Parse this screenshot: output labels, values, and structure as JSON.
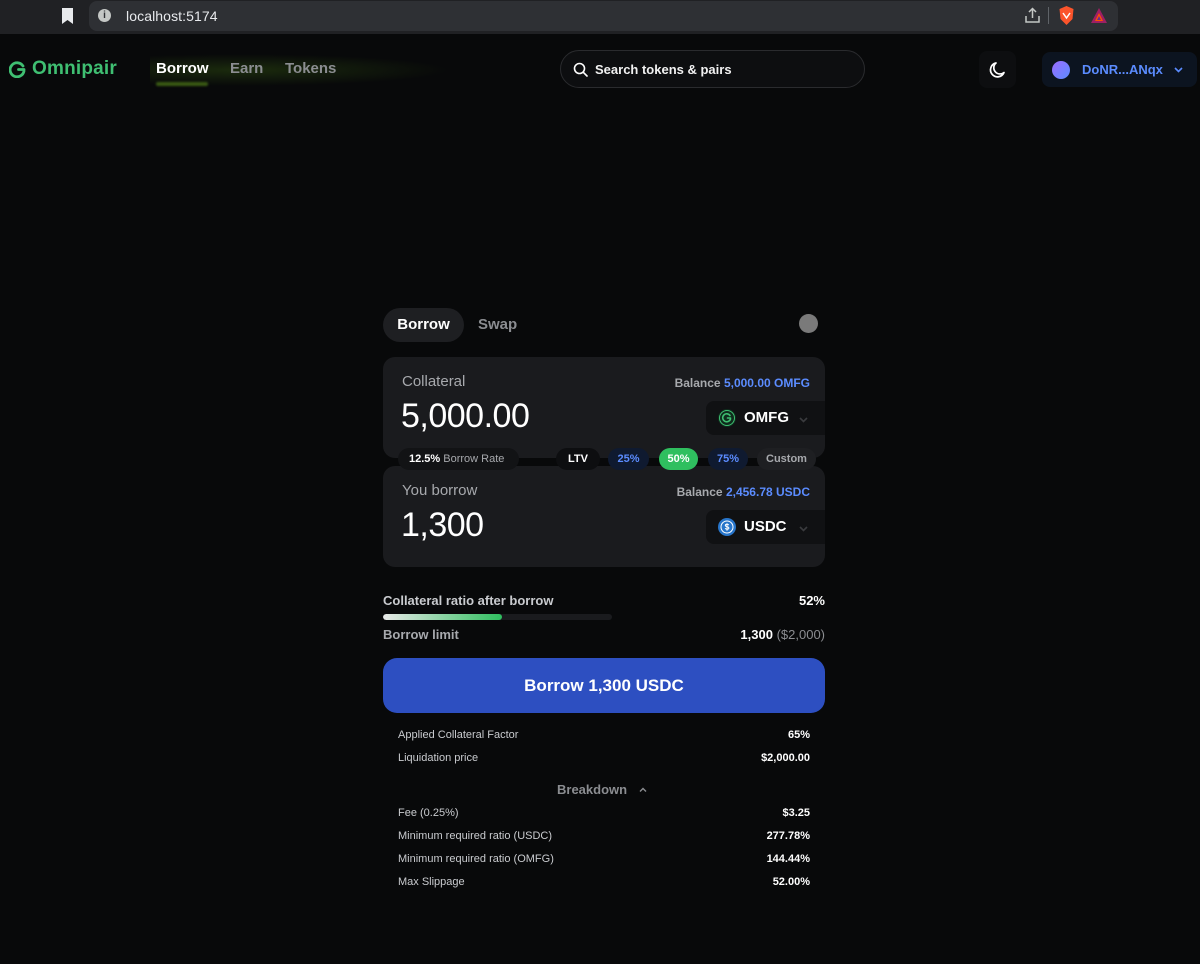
{
  "browser": {
    "url": "localhost:5174"
  },
  "header": {
    "logo": "Omnipair",
    "nav": {
      "borrow": "Borrow",
      "earn": "Earn",
      "tokens": "Tokens"
    },
    "search_placeholder": "Search tokens & pairs",
    "wallet": "DoNR...ANqx"
  },
  "tabs": {
    "borrow": "Borrow",
    "swap": "Swap"
  },
  "collateral": {
    "label": "Collateral",
    "balance_label": "Balance",
    "balance_value": "5,000.00 OMFG",
    "amount": "5,000.00",
    "token": "OMFG"
  },
  "rate": {
    "value": "12.5%",
    "label": "Borrow Rate"
  },
  "ltv": {
    "label": "LTV",
    "options": [
      "25%",
      "50%",
      "75%",
      "Custom"
    ],
    "selected": "50%"
  },
  "borrow": {
    "label": "You borrow",
    "balance_label": "Balance",
    "balance_value": "2,456.78 USDC",
    "amount": "1,300",
    "token": "USDC"
  },
  "ratio": {
    "label": "Collateral ratio after borrow",
    "value": "52%",
    "fill_percent": 52
  },
  "limit": {
    "label": "Borrow limit",
    "value": "1,300",
    "sub": "($2,000)"
  },
  "action": {
    "label": "Borrow 1,300 USDC"
  },
  "details": [
    {
      "label": "Applied Collateral Factor",
      "value": "65%"
    },
    {
      "label": "Liquidation price",
      "value": "$2,000.00"
    }
  ],
  "breakdown": {
    "label": "Breakdown",
    "rows": [
      {
        "label": "Fee (0.25%)",
        "value": "$3.25"
      },
      {
        "label": "Minimum required ratio (USDC)",
        "value": "277.78%"
      },
      {
        "label": "Minimum required ratio (OMFG)",
        "value": "144.44%"
      },
      {
        "label": "Max Slippage",
        "value": "52.00%"
      }
    ]
  },
  "colors": {
    "accent_green": "#3fbf72",
    "accent_blue": "#5b8cff",
    "button_blue": "#2d4fc1"
  }
}
